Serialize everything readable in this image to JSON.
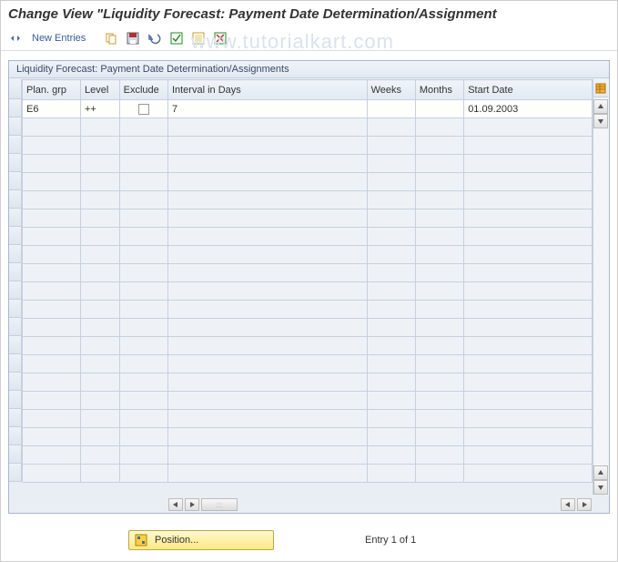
{
  "title": "Change View \"Liquidity Forecast: Payment Date Determination/Assignment",
  "toolbar": {
    "new_entries": "New Entries"
  },
  "watermark": "www.tutorialkart.com",
  "panel": {
    "title": "Liquidity Forecast: Payment Date Determination/Assignments",
    "columns": {
      "plan_grp": "Plan. grp",
      "level": "Level",
      "exclude": "Exclude",
      "interval_days": "Interval in Days",
      "weeks": "Weeks",
      "months": "Months",
      "start_date": "Start Date"
    },
    "rows": [
      {
        "plan_grp": "E6",
        "level": "++",
        "exclude": false,
        "interval_days": "7",
        "weeks": "",
        "months": "",
        "start_date": "01.09.2003"
      }
    ]
  },
  "footer": {
    "position_label": "Position...",
    "entry_text": "Entry 1 of 1"
  }
}
